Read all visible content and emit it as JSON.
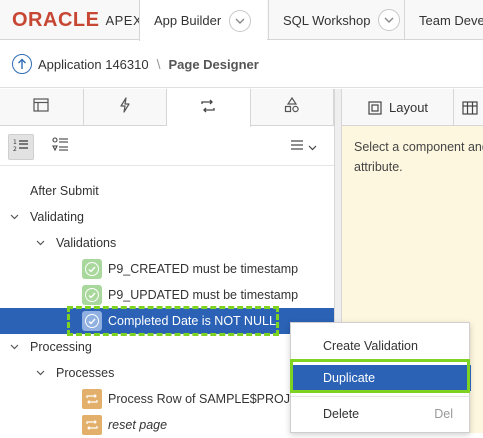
{
  "brand": {
    "oracle": "ORACLE",
    "apex": "APEX"
  },
  "nav": {
    "tabs": [
      {
        "label": "App Builder"
      },
      {
        "label": "SQL Workshop"
      },
      {
        "label": "Team Develo"
      }
    ]
  },
  "breadcrumb": {
    "application": "Application 146310",
    "separator": "\\",
    "page": "Page Designer"
  },
  "left_tabs": [
    "rendering-icon",
    "dynamic-actions-icon",
    "processing-icon",
    "shared-components-icon"
  ],
  "tree": {
    "rows": [
      {
        "label": "After Submit",
        "level": 0,
        "caret": "none",
        "icon": "none"
      },
      {
        "label": "Validating",
        "level": 0,
        "caret": "down",
        "icon": "none"
      },
      {
        "label": "Validations",
        "level": 1,
        "caret": "down",
        "icon": "none"
      },
      {
        "label": "P9_CREATED must be timestamp",
        "level": 2,
        "caret": "none",
        "icon": "validation-icon"
      },
      {
        "label": "P9_UPDATED must be timestamp",
        "level": 2,
        "caret": "none",
        "icon": "validation-icon"
      },
      {
        "label": "Completed Date is NOT NULL",
        "level": 2,
        "caret": "none",
        "icon": "validation-icon",
        "selected": true
      },
      {
        "label": "Processing",
        "level": 0,
        "caret": "down",
        "icon": "none"
      },
      {
        "label": "Processes",
        "level": 1,
        "caret": "down",
        "icon": "none"
      },
      {
        "label": "Process Row of SAMPLE$PROJEC",
        "level": 2,
        "caret": "none",
        "icon": "process-icon"
      },
      {
        "label": "reset page",
        "level": 2,
        "caret": "none",
        "icon": "process-icon",
        "italic": true
      }
    ]
  },
  "right_panel": {
    "tabs": [
      {
        "label": "Layout"
      }
    ],
    "message": "Select a component and attribute."
  },
  "context_menu": {
    "items": [
      {
        "label": "Create Validation",
        "shortcut": ""
      },
      {
        "label": "Duplicate",
        "shortcut": ""
      },
      {
        "label": "Delete",
        "shortcut": "Del"
      }
    ]
  },
  "colors": {
    "accent": "#2b62b5",
    "highlight": "#7ed321",
    "oracle_red": "#c74634",
    "validation_green": "#a9d89c",
    "process_orange": "#e3b06b",
    "message_bg": "#fdf7df"
  }
}
